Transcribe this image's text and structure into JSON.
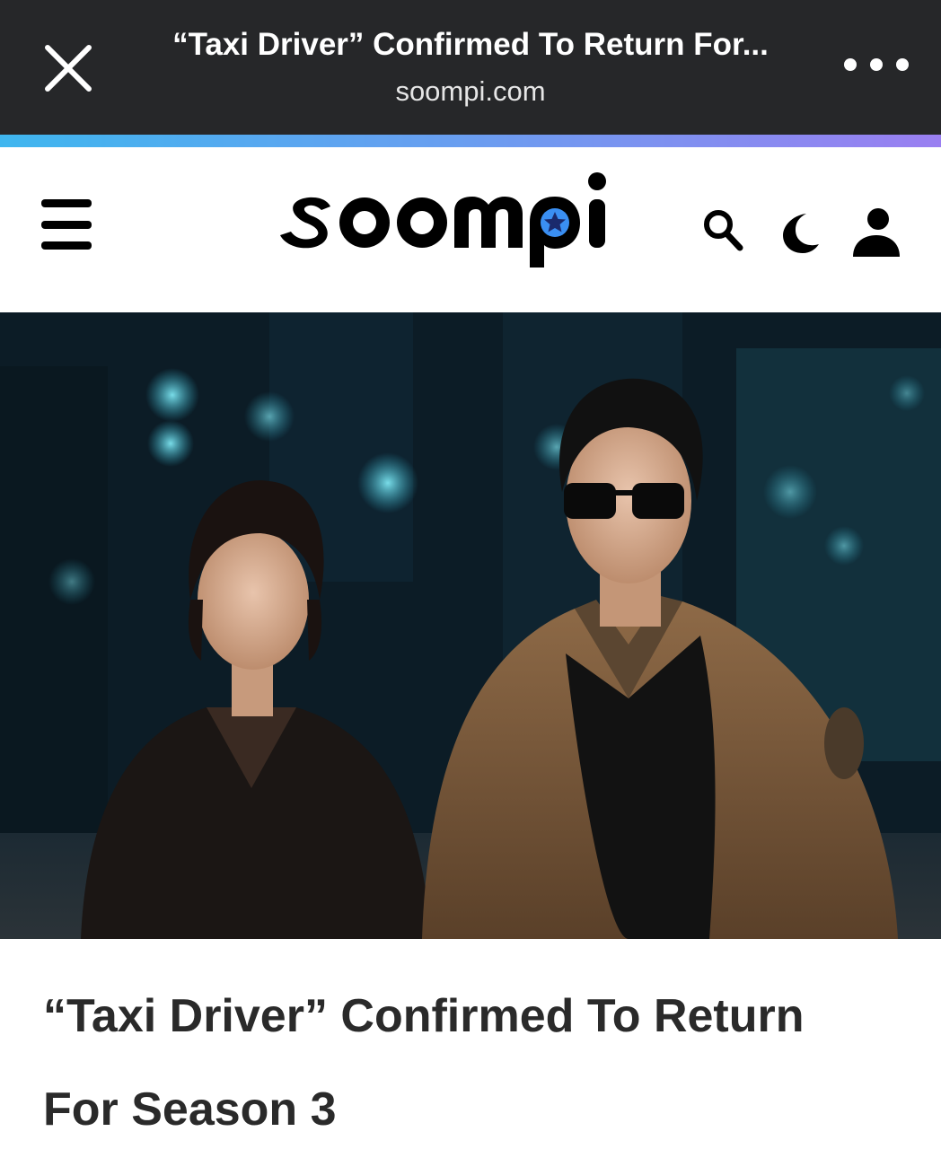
{
  "browser": {
    "tab_title": "“Taxi Driver” Confirmed To Return For...",
    "url": "soompi.com",
    "close_icon": "close-icon",
    "more_icon": "more-dots-icon"
  },
  "header": {
    "logo_text": "soompi",
    "menu_icon": "hamburger-menu-icon",
    "search_icon": "search-icon",
    "theme_icon": "moon-icon",
    "account_icon": "user-icon",
    "accent_colors": [
      "#3fb6ef",
      "#9a7ff1"
    ]
  },
  "article": {
    "image_alt": "Two actors posing at night in front of city lights",
    "headline": "“Taxi Driver” Confirmed To Return For Season 3"
  }
}
